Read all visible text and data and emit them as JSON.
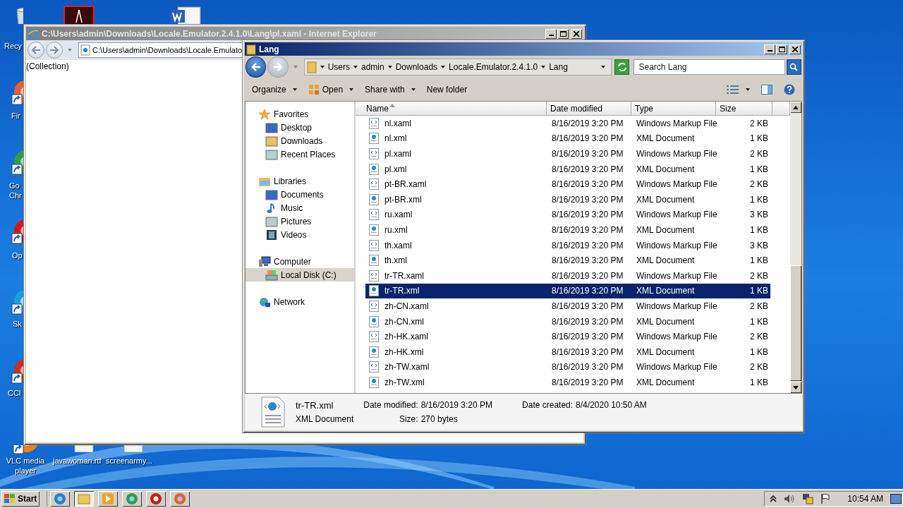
{
  "desktop_icons": [
    {
      "label": "Recy"
    },
    {
      "label": "Fir"
    },
    {
      "label": "Go Chr"
    },
    {
      "label": "Op"
    },
    {
      "label": "Sk"
    },
    {
      "label": "CCl"
    },
    {
      "label": "VLC media player"
    },
    {
      "label": "javawoman.rtf"
    },
    {
      "label": "screenarmy..."
    }
  ],
  "ie_window": {
    "title": "C:\\Users\\admin\\Downloads\\Locale.Emulator.2.4.1.0\\Lang\\pl.xaml - Internet Explorer",
    "address": "C:\\Users\\admin\\Downloads\\Locale.Emulato",
    "content": "(Collection)"
  },
  "explorer": {
    "title": "Lang",
    "breadcrumb": [
      "Users",
      "admin",
      "Downloads",
      "Locale.Emulator.2.4.1.0",
      "Lang"
    ],
    "search": {
      "placeholder": "Search Lang"
    },
    "toolbar": [
      {
        "label": "Organize",
        "dropdown": true
      },
      {
        "label": "Open",
        "dropdown": true
      },
      {
        "label": "Share with",
        "dropdown": true
      },
      {
        "label": "New folder",
        "dropdown": false
      }
    ],
    "sidebar": [
      {
        "label": "Favorites",
        "selected": false,
        "children": [
          {
            "label": "Desktop",
            "selected": false
          },
          {
            "label": "Downloads",
            "selected": false
          },
          {
            "label": "Recent Places",
            "selected": false
          }
        ]
      },
      {
        "label": "Libraries",
        "selected": false,
        "children": [
          {
            "label": "Documents",
            "selected": false
          },
          {
            "label": "Music",
            "selected": false
          },
          {
            "label": "Pictures",
            "selected": false
          },
          {
            "label": "Videos",
            "selected": false
          }
        ]
      },
      {
        "label": "Computer",
        "selected": false,
        "children": [
          {
            "label": "Local Disk (C:)",
            "selected": true
          }
        ]
      },
      {
        "label": "Network",
        "selected": false
      }
    ],
    "columns": [
      "Name",
      "Date modified",
      "Type",
      "Size"
    ],
    "files": [
      {
        "name": "nl.xaml",
        "date": "8/16/2019 3:20 PM",
        "type": "Windows Markup File",
        "size": "2 KB",
        "kind": "xaml",
        "selected": false
      },
      {
        "name": "nl.xml",
        "date": "8/16/2019 3:20 PM",
        "type": "XML Document",
        "size": "1 KB",
        "kind": "xml",
        "selected": false
      },
      {
        "name": "pl.xaml",
        "date": "8/16/2019 3:20 PM",
        "type": "Windows Markup File",
        "size": "2 KB",
        "kind": "xaml",
        "selected": false
      },
      {
        "name": "pl.xml",
        "date": "8/16/2019 3:20 PM",
        "type": "XML Document",
        "size": "1 KB",
        "kind": "xml",
        "selected": false
      },
      {
        "name": "pt-BR.xaml",
        "date": "8/16/2019 3:20 PM",
        "type": "Windows Markup File",
        "size": "2 KB",
        "kind": "xaml",
        "selected": false
      },
      {
        "name": "pt-BR.xml",
        "date": "8/16/2019 3:20 PM",
        "type": "XML Document",
        "size": "1 KB",
        "kind": "xml",
        "selected": false
      },
      {
        "name": "ru.xaml",
        "date": "8/16/2019 3:20 PM",
        "type": "Windows Markup File",
        "size": "3 KB",
        "kind": "xaml",
        "selected": false
      },
      {
        "name": "ru.xml",
        "date": "8/16/2019 3:20 PM",
        "type": "XML Document",
        "size": "1 KB",
        "kind": "xml",
        "selected": false
      },
      {
        "name": "th.xaml",
        "date": "8/16/2019 3:20 PM",
        "type": "Windows Markup File",
        "size": "3 KB",
        "kind": "xaml",
        "selected": false
      },
      {
        "name": "th.xml",
        "date": "8/16/2019 3:20 PM",
        "type": "XML Document",
        "size": "1 KB",
        "kind": "xml",
        "selected": false
      },
      {
        "name": "tr-TR.xaml",
        "date": "8/16/2019 3:20 PM",
        "type": "Windows Markup File",
        "size": "2 KB",
        "kind": "xaml",
        "selected": false
      },
      {
        "name": "tr-TR.xml",
        "date": "8/16/2019 3:20 PM",
        "type": "XML Document",
        "size": "1 KB",
        "kind": "xml",
        "selected": true
      },
      {
        "name": "zh-CN.xaml",
        "date": "8/16/2019 3:20 PM",
        "type": "Windows Markup File",
        "size": "2 KB",
        "kind": "xaml",
        "selected": false
      },
      {
        "name": "zh-CN.xml",
        "date": "8/16/2019 3:20 PM",
        "type": "XML Document",
        "size": "1 KB",
        "kind": "xml",
        "selected": false
      },
      {
        "name": "zh-HK.xaml",
        "date": "8/16/2019 3:20 PM",
        "type": "Windows Markup File",
        "size": "2 KB",
        "kind": "xaml",
        "selected": false
      },
      {
        "name": "zh-HK.xml",
        "date": "8/16/2019 3:20 PM",
        "type": "XML Document",
        "size": "1 KB",
        "kind": "xml",
        "selected": false
      },
      {
        "name": "zh-TW.xaml",
        "date": "8/16/2019 3:20 PM",
        "type": "Windows Markup File",
        "size": "2 KB",
        "kind": "xaml",
        "selected": false
      },
      {
        "name": "zh-TW.xml",
        "date": "8/16/2019 3:20 PM",
        "type": "XML Document",
        "size": "1 KB",
        "kind": "xml",
        "selected": false
      }
    ],
    "details": {
      "name": "tr-TR.xml",
      "type": "XML Document",
      "modified_label": "Date modified:",
      "modified": "8/16/2019 3:20 PM",
      "size_label": "Size:",
      "size": "270 bytes",
      "created_label": "Date created:",
      "created": "8/4/2020 10:50 AM"
    }
  },
  "taskbar": {
    "start": "Start",
    "apps": [
      {
        "selected": false
      },
      {
        "selected": true
      },
      {
        "selected": false
      },
      {
        "selected": false
      },
      {
        "selected": false
      },
      {
        "selected": false
      }
    ],
    "clock": "10:54 AM"
  }
}
